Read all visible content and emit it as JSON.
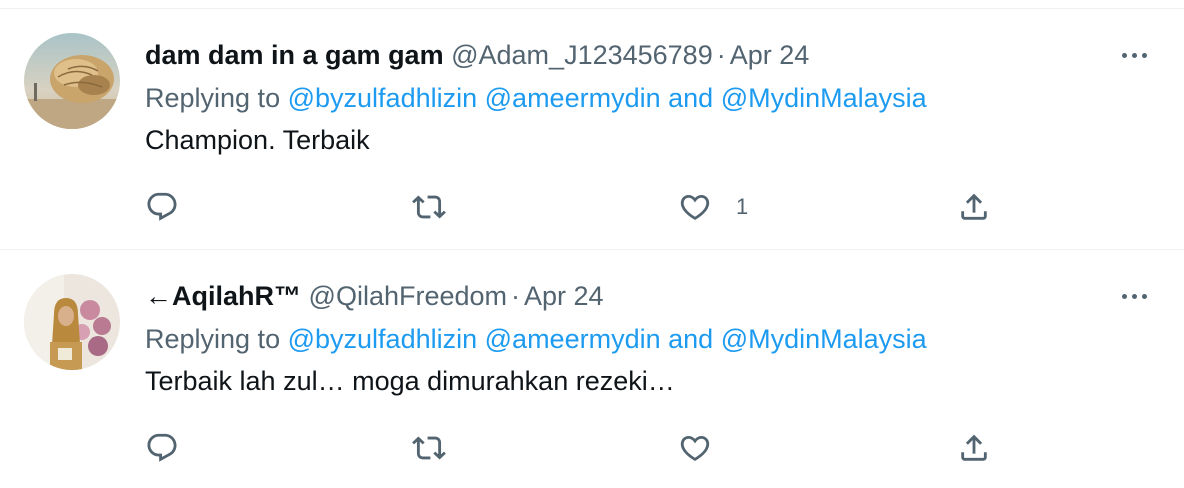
{
  "tweets": [
    {
      "display_name": "dam dam in a gam gam",
      "handle": "@Adam_J123456789",
      "separator": "·",
      "date": "Apr 24",
      "replying_prefix": "Replying to",
      "mention_1": "@byzulfadhlizin",
      "mention_2": "@ameermydin",
      "conjunction": "and",
      "mention_3": "@MydinMalaysia",
      "text": "Champion. Terbaik",
      "like_count": "1",
      "avatar_icon": "avatar-photo-driftwood"
    },
    {
      "display_name": "←AqilahR™",
      "handle": "@QilahFreedom",
      "separator": "·",
      "date": "Apr 24",
      "replying_prefix": "Replying to",
      "mention_1": "@byzulfadhlizin",
      "mention_2": "@ameermydin",
      "conjunction": "and",
      "mention_3": "@MydinMalaysia",
      "text": "Terbaik lah zul… moga dimurahkan rezeki…",
      "like_count": "",
      "avatar_icon": "avatar-photo-woman-flowers"
    }
  ],
  "colors": {
    "link": "#1d9bf0",
    "secondary_text": "#536471",
    "primary_text": "#0f1419",
    "divider": "#eff3f4"
  },
  "icons": [
    "reply-icon",
    "retweet-icon",
    "like-icon",
    "share-icon",
    "more-icon"
  ]
}
